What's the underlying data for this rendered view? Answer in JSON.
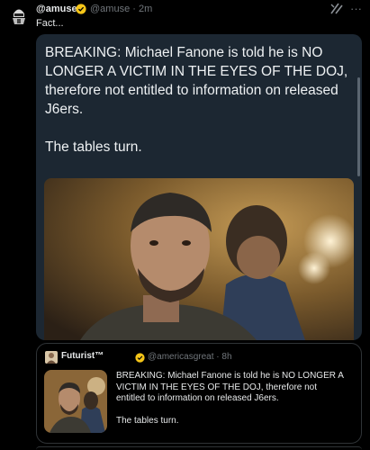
{
  "post": {
    "display_name": "@amuse",
    "handle_time": "@amuse · 2m",
    "text": "Fact...",
    "grok_icon": "slash-logo-icon",
    "more_label": "···"
  },
  "quote": {
    "lines": [
      "BREAKING: Michael Fanone is told he is NO",
      "LONGER A VICTIM IN THE EYES OF THE DOJ,",
      "therefore not entitled to information on released",
      "J6ers."
    ],
    "closing": "The tables turn."
  },
  "embed": {
    "display_name": "Futurist™",
    "handle_time": "@americasgreat · 8h",
    "lines": [
      "BREAKING: Michael Fanone is told he is NO LONGER A",
      "VICTIM IN THE EYES OF THE DOJ, therefore not",
      "entitled to information on released J6ers."
    ],
    "closing": "The tables turn."
  },
  "colors": {
    "background": "#000000",
    "card": "#1c2732",
    "verified": "#f5c518",
    "muted": "#71767b"
  }
}
